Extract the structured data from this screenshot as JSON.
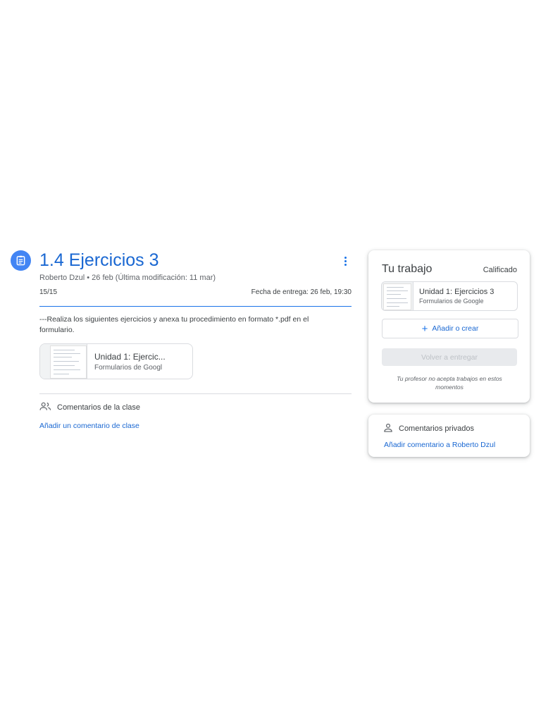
{
  "assignment": {
    "icon": "assignment-icon",
    "title": "1.4 Ejercicios 3",
    "meta": "Roberto Dzul • 26 feb (Última modificación: 11 mar)",
    "points": "15/15",
    "due": "Fecha de entrega: 26 feb, 19:30",
    "description": "---Realiza los siguientes ejercicios y anexa tu procedimiento en formato *.pdf en el formulario.",
    "attachment": {
      "title": "Unidad 1: Ejercic...",
      "subtitle": "Formularios de Googl"
    }
  },
  "class_comments": {
    "icon": "people-icon",
    "heading": "Comentarios de la clase",
    "add_link": "Añadir un comentario de clase"
  },
  "your_work": {
    "title": "Tu trabajo",
    "status": "Calificado",
    "attachment": {
      "title": "Unidad 1: Ejercicios 3",
      "subtitle": "Formularios de Google"
    },
    "add_create_label": "Añadir o crear",
    "resubmit_label": "Volver a entregar",
    "notice": "Tu profesor no acepta trabajos en estos momentos"
  },
  "private_comments": {
    "icon": "person-icon",
    "heading": "Comentarios privados",
    "add_link": "Añadir comentario a Roberto Dzul"
  },
  "colors": {
    "accent": "#1967d2",
    "icon_bg": "#4285f4",
    "text": "#3c4043",
    "disabled_bg": "#e8eaed"
  }
}
